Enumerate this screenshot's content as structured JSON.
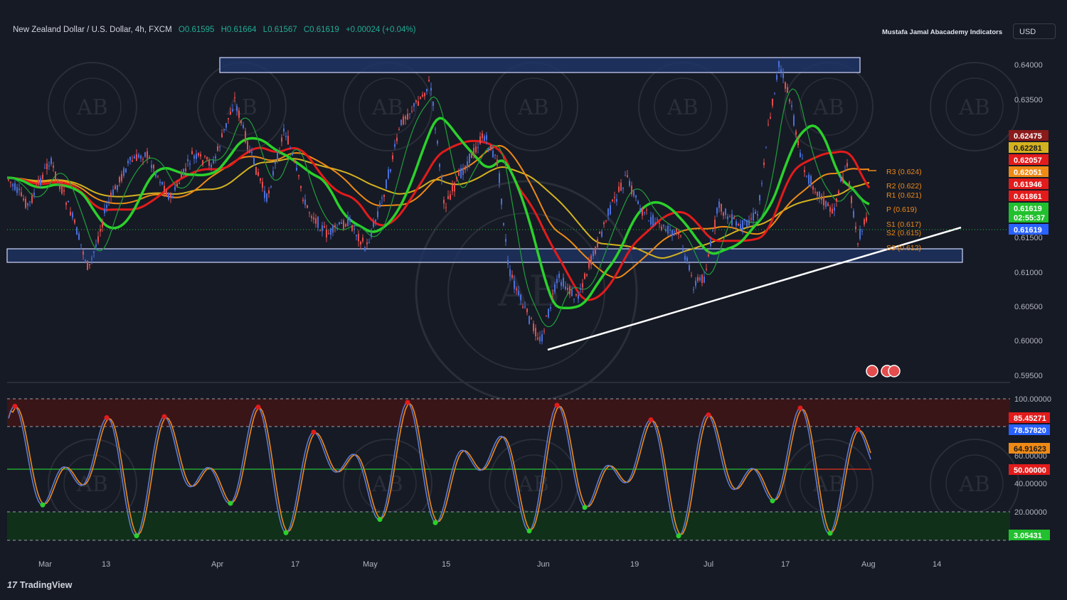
{
  "header": {
    "symbol": "New Zealand Dollar / U.S. Dollar, 4h, FXCM",
    "open": "O0.61595",
    "high": "H0.61664",
    "low": "L0.61567",
    "close": "C0.61619",
    "change": "+0.00024 (+0.04%)"
  },
  "indicator_name": "Mustafa Jamal Abacademy Indicators",
  "currency_button": "USD",
  "brand": "TradingView",
  "watermark_text": "AB",
  "price_axis": {
    "ticks": [
      "0.64000",
      "0.63500",
      "0.61500",
      "0.61000",
      "0.60500",
      "0.60000",
      "0.59500"
    ]
  },
  "price_badges": [
    {
      "text": "0.62475",
      "color": "#8b1a1a"
    },
    {
      "text": "0.62281",
      "color": "#d4b21f"
    },
    {
      "text": "0.62057",
      "color": "#e31b1b"
    },
    {
      "text": "0.62051",
      "color": "#ef8a16"
    },
    {
      "text": "0.61946",
      "color": "#e31b1b"
    },
    {
      "text": "0.61861",
      "color": "#e31b1b"
    },
    {
      "text": "0.61619",
      "color": "#22c02e"
    },
    {
      "text": "02:55:37",
      "color": "#22c02e"
    },
    {
      "text": "0.61619",
      "color": "#2962ff"
    }
  ],
  "pivot_levels": [
    {
      "label": "R3 (0.624)"
    },
    {
      "label": "R2 (0.622)"
    },
    {
      "label": "R1 (0.621)"
    },
    {
      "label": "P (0.619)"
    },
    {
      "label": "S1 (0.617)"
    },
    {
      "label": "S2 (0.615)"
    },
    {
      "label": "S3 (0.612)"
    }
  ],
  "oscillator_axis": {
    "ticks": [
      "100.00000",
      "60.00000",
      "40.00000",
      "20.00000"
    ]
  },
  "oscillator_badges": [
    {
      "text": "85.45271",
      "color": "#e31b1b"
    },
    {
      "text": "78.57820",
      "color": "#2962ff"
    },
    {
      "text": "64.91623",
      "color": "#ef8a16"
    },
    {
      "text": "50.00000",
      "color": "#e31b1b"
    },
    {
      "text": "3.05431",
      "color": "#22c02e"
    }
  ],
  "time_axis": {
    "labels": [
      "Mar",
      "13",
      "Apr",
      "17",
      "May",
      "15",
      "Jun",
      "19",
      "Jul",
      "17",
      "Aug",
      "14"
    ]
  },
  "colors": {
    "background": "#161a25",
    "bull_candle": "#4a6fd9",
    "bear_candle": "#e34d4d",
    "zone_fill": "#1f3566",
    "trendline": "#ffffff",
    "ma_red": "#e31b1b",
    "ma_green": "#2bd12b",
    "ma_orange": "#ef8a16",
    "ma_yellow": "#d4b21f",
    "osc_k": "#5b7bd5",
    "osc_d": "#ef8a16",
    "overbought_fill": "#3a1518",
    "oversold_fill": "#10301a"
  }
}
